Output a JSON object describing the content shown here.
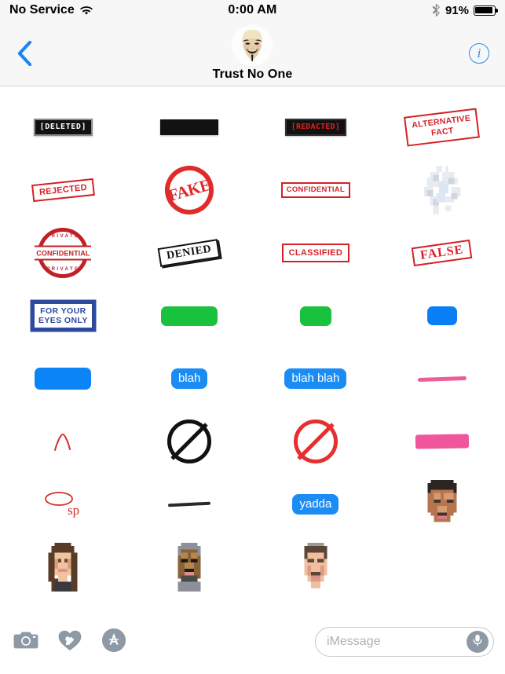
{
  "status_bar": {
    "carrier": "No Service",
    "wifi_icon": "wifi-icon",
    "time": "0:00 AM",
    "bluetooth_icon": "bluetooth-icon",
    "battery_percent": "91%",
    "battery_level": 91
  },
  "nav_bar": {
    "back_icon": "chevron-left-icon",
    "avatar_icon": "guy-fawkes-mask-avatar",
    "title": "Trust No One",
    "info_icon": "info-icon",
    "info_label": "i"
  },
  "stickers": {
    "rows": [
      [
        {
          "name": "sticker-deleted",
          "kind": "plate",
          "label": "[DELETED]"
        },
        {
          "name": "sticker-black-bar",
          "kind": "blackbar",
          "label": ""
        },
        {
          "name": "sticker-redacted",
          "kind": "plate-red",
          "label": "[REDACTED]"
        },
        {
          "name": "sticker-alternative-fact",
          "kind": "stamp-alt",
          "label": "ALTERNATIVE FACT",
          "line1": "ALTERNATIVE",
          "line2": "FACT"
        }
      ],
      [
        {
          "name": "sticker-rejected",
          "kind": "stamp-rejected",
          "label": "REJECTED"
        },
        {
          "name": "sticker-fake",
          "kind": "fake-circle",
          "label": "FAKE"
        },
        {
          "name": "sticker-confidential-box",
          "kind": "stamp-conf2",
          "label": "CONFIDENTIAL"
        },
        {
          "name": "sticker-pixel-blur",
          "kind": "pixel-blur",
          "label": ""
        }
      ],
      [
        {
          "name": "sticker-confidential-round",
          "kind": "round-stamp",
          "label": "CONFIDENTIAL",
          "arc_top": "PRIVATE",
          "arc_bottom": "PRIVATE"
        },
        {
          "name": "sticker-denied",
          "kind": "stamp-denied",
          "label": "DENIED"
        },
        {
          "name": "sticker-classified",
          "kind": "stamp-classified",
          "label": "CLASSIFIED"
        },
        {
          "name": "sticker-false",
          "kind": "stamp-false",
          "label": "FALSE"
        }
      ],
      [
        {
          "name": "sticker-for-your-eyes-only",
          "kind": "eyes-only",
          "label": "FOR YOUR EYES ONLY",
          "line1": "FOR YOUR",
          "line2": "EYES ONLY"
        },
        {
          "name": "sticker-green-bar-large",
          "kind": "bar-green-lg",
          "label": ""
        },
        {
          "name": "sticker-green-bar-small",
          "kind": "bar-green-sm",
          "label": ""
        },
        {
          "name": "sticker-blue-bar-small",
          "kind": "bar-blue-sm",
          "label": ""
        }
      ],
      [
        {
          "name": "sticker-blue-bar-large",
          "kind": "bar-blue-lg",
          "label": ""
        },
        {
          "name": "sticker-blah-bubble",
          "kind": "bubble",
          "label": "blah"
        },
        {
          "name": "sticker-blah-blah-bubble",
          "kind": "bubble",
          "label": "blah  blah"
        },
        {
          "name": "sticker-pink-thin-stroke",
          "kind": "pink-thin",
          "label": ""
        }
      ],
      [
        {
          "name": "sticker-red-caret-mark",
          "kind": "caret",
          "label": ""
        },
        {
          "name": "sticker-black-prohibition-sign",
          "kind": "noentry-black",
          "label": ""
        },
        {
          "name": "sticker-red-prohibition-sign",
          "kind": "noentry-red",
          "label": ""
        },
        {
          "name": "sticker-pink-highlighter-block",
          "kind": "pink-thick",
          "label": ""
        }
      ],
      [
        {
          "name": "sticker-spelling-mark",
          "kind": "sp-mark",
          "label": "sp"
        },
        {
          "name": "sticker-black-strikethrough",
          "kind": "black-line",
          "label": ""
        },
        {
          "name": "sticker-yadda-bubble",
          "kind": "bubble",
          "label": "yadda"
        },
        {
          "name": "sticker-pixelated-face-1",
          "kind": "pixface-dark",
          "label": ""
        }
      ],
      [
        {
          "name": "sticker-pixelated-face-2",
          "kind": "pixface-long",
          "label": ""
        },
        {
          "name": "sticker-pixelated-face-3",
          "kind": "pixface-beard",
          "label": ""
        },
        {
          "name": "sticker-pixelated-face-4",
          "kind": "pixface-light",
          "label": ""
        },
        {
          "name": "sticker-empty-slot",
          "kind": "empty",
          "label": ""
        }
      ]
    ]
  },
  "bottom_bar": {
    "camera_icon": "camera-icon",
    "digital_touch_icon": "heart-stylus-icon",
    "app_store_icon": "app-store-icon",
    "message_placeholder": "iMessage",
    "message_value": "",
    "mic_icon": "microphone-icon"
  },
  "colors": {
    "imessage_blue": "#1c8cf5",
    "stamp_red": "#d62027",
    "navy": "#2e4a9e",
    "green": "#18c23e",
    "pink": "#ec4f96",
    "toolbar_gray": "#8e99a6",
    "chrome_gray": "#f7f7f7"
  }
}
